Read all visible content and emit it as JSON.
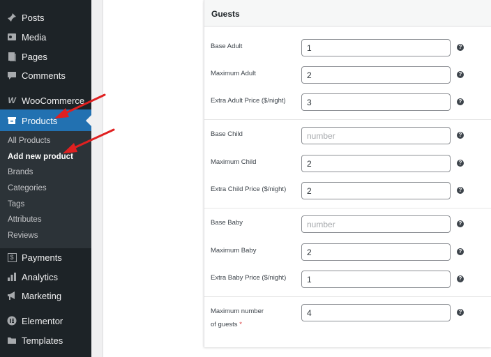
{
  "sidebar": {
    "menu": [
      {
        "label": "Posts",
        "icon": "pin-icon"
      },
      {
        "label": "Media",
        "icon": "media-icon"
      },
      {
        "label": "Pages",
        "icon": "pages-icon"
      },
      {
        "label": "Comments",
        "icon": "comments-icon"
      },
      {
        "label": "WooCommerce",
        "icon": "woocommerce-icon",
        "icon_text": "W"
      },
      {
        "label": "Products",
        "icon": "archive-icon"
      },
      {
        "label": "Payments",
        "icon": "payments-icon",
        "icon_text": "$"
      },
      {
        "label": "Analytics",
        "icon": "chart-bar-icon"
      },
      {
        "label": "Marketing",
        "icon": "megaphone-icon"
      },
      {
        "label": "Elementor",
        "icon": "elementor-icon"
      },
      {
        "label": "Templates",
        "icon": "folder-icon"
      }
    ],
    "submenu": [
      {
        "label": "All Products"
      },
      {
        "label": "Add new product",
        "current": true
      },
      {
        "label": "Brands"
      },
      {
        "label": "Categories"
      },
      {
        "label": "Tags"
      },
      {
        "label": "Attributes"
      },
      {
        "label": "Reviews"
      }
    ],
    "active_color": "#2271b1"
  },
  "panel": {
    "title": "Guests",
    "help_glyph": "?",
    "required_mark": "*",
    "fields": [
      {
        "label": "Base Adult",
        "value": "1",
        "placeholder": ""
      },
      {
        "label": "Maximum Adult",
        "value": "2",
        "placeholder": ""
      },
      {
        "label": "Extra Adult Price ($/night)",
        "value": "3",
        "placeholder": ""
      },
      {
        "label": "Base Child",
        "value": "",
        "placeholder": "number"
      },
      {
        "label": "Maximum Child",
        "value": "2",
        "placeholder": ""
      },
      {
        "label": "Extra Child Price ($/night)",
        "value": "2",
        "placeholder": ""
      },
      {
        "label": "Base Baby",
        "value": "",
        "placeholder": "number"
      },
      {
        "label": "Maximum Baby",
        "value": "2",
        "placeholder": ""
      },
      {
        "label": "Extra Baby Price ($/night)",
        "value": "1",
        "placeholder": ""
      },
      {
        "label_line1": "Maximum number",
        "label_line2": "of guests",
        "value": "4",
        "placeholder": ""
      }
    ]
  },
  "annotation_color": "#e02020"
}
